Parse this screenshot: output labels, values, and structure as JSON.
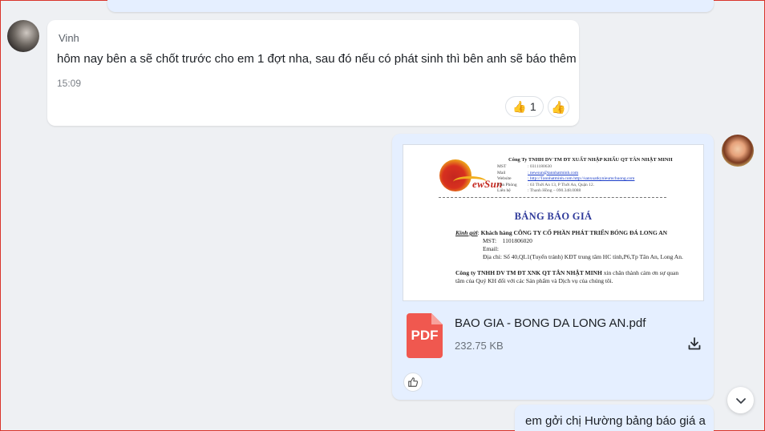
{
  "incoming_message": {
    "sender": "Vinh",
    "text": "hôm nay bên a sẽ chốt trước cho em 1 đợt nha, sau đó nếu có phát sinh thì bên anh sẽ báo thêm",
    "time": "15:09",
    "reaction_icon": "👍",
    "reaction_count": "1",
    "react_button_icon": "👍"
  },
  "outgoing_file": {
    "file_name": "BAO GIA - BONG DA LONG AN.pdf",
    "file_size": "232.75 KB",
    "file_type_label": "PDF",
    "preview": {
      "company_name": "Công Ty TNHH DV TM ĐT XUẤT NHẬP KHẨU QT TÂN NHẬT MINH",
      "logo_text": "ewSun",
      "info_rows": [
        {
          "k": "MST",
          "v": ": 0311180630"
        },
        {
          "k": "Mail",
          "v": ": newsun@tannhatminh.com"
        },
        {
          "k": "Website",
          "v": ": http://Tannhatminh.com  http://sanxuatkynieumchuong.com"
        },
        {
          "k": "Văn Phòng",
          "v": ": 63 Thới An 13, P Thới An, Quận 12."
        },
        {
          "k": "Liên hệ",
          "v": ": Thanh Hồng – 090.348.0088"
        }
      ],
      "title": "BẢNG BÁO GIÁ",
      "greeting_label": "Kính gửi",
      "customer": "Khách hàng CÔNG TY CỔ PHẦN PHÁT TRIỂN BÓNG ĐÁ LONG AN",
      "mst_label": "MST:",
      "mst_value": "1101806020",
      "email_label": "Email:",
      "address": "Địa chỉ: Số 40,QL1(Tuyến tránh) KĐT trung tâm HC tỉnh,P6,Tp Tân An, Long An.",
      "closing_company": "Công ty TNHH DV TM ĐT XNK QT TÂN NHẬT MINH",
      "closing_text": "xin chân thành cảm ơn sự quan tâm của Quý KH đối với các Sản phẩm và Dịch vụ của chúng tôi."
    }
  },
  "next_message": {
    "text": "em gởi chị Hường bảng báo giá a"
  },
  "colors": {
    "background": "#eef0f3",
    "incoming_bubble": "#ffffff",
    "outgoing_bubble": "#e5efff",
    "pdf_red": "#f0584f",
    "doc_title_blue": "#2f3a9a"
  },
  "icons": {
    "download": "download-icon",
    "like": "thumbs-up-outline-icon",
    "scroll_down": "chevron-down-icon"
  }
}
